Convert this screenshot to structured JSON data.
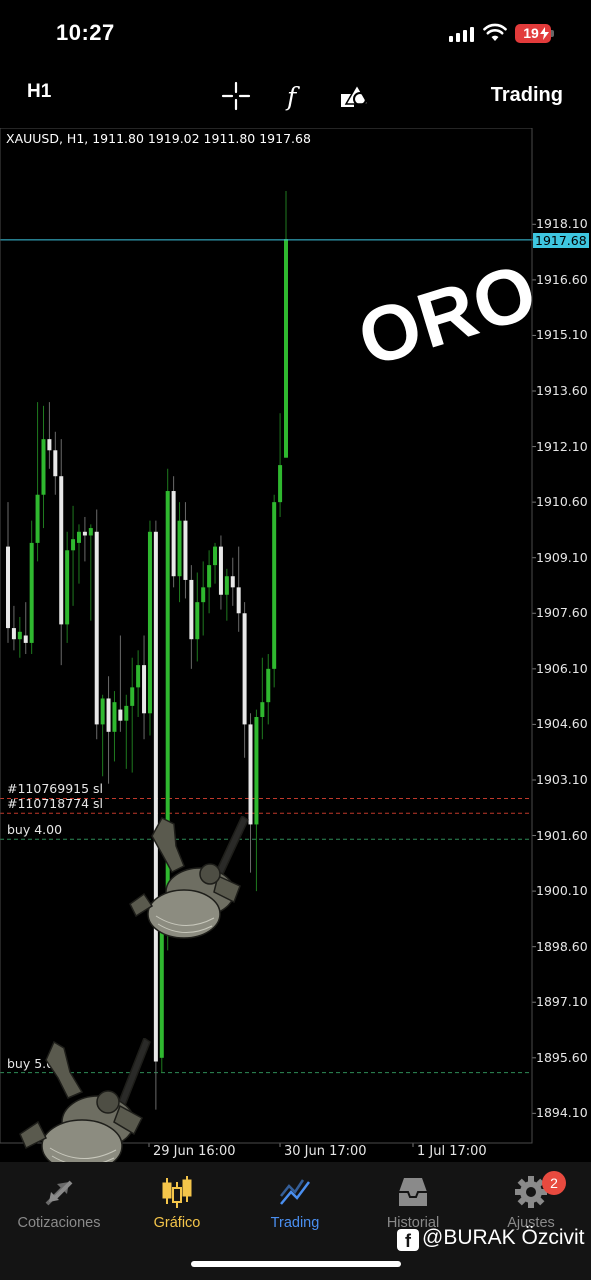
{
  "status_bar": {
    "time": "10:27",
    "battery": "19",
    "battery_color": "#e23b3b"
  },
  "toolbar": {
    "timeframe": "H1",
    "icons": [
      "crosshair-icon",
      "function-icon",
      "objects-icon"
    ],
    "trading_label": "Trading"
  },
  "chart": {
    "header": "XAUUSD, H1, 1911.80 1919.02 1911.80 1917.68",
    "current_price": "1917.68",
    "current_price_color": "#3ec6e0",
    "price_labels": [
      "1918.10",
      "1916.60",
      "1915.10",
      "1913.60",
      "1912.10",
      "1910.60",
      "1909.10",
      "1907.60",
      "1906.10",
      "1904.60",
      "1903.10",
      "1901.60",
      "1900.10",
      "1898.60",
      "1897.10",
      "1895.60",
      "1894.10"
    ],
    "time_labels": [
      "29 Jun 16:00",
      "30 Jun 17:00",
      "1 Jul 17:00"
    ],
    "orders": [
      {
        "label": "#110769915 sl",
        "price": 1902.6,
        "color": "#c0392b"
      },
      {
        "label": "#110718774 sl",
        "price": 1902.2,
        "color": "#c0392b"
      },
      {
        "label": "buy 4.00",
        "price": 1901.5,
        "color": "#2e8b57"
      },
      {
        "label": "buy 5.00",
        "price": 1895.2,
        "color": "#2e8b57"
      }
    ],
    "overlay_text": "ORO",
    "up_color": "#2fb82f",
    "down_color": "#e8e8e8"
  },
  "chart_data": {
    "type": "candlestick",
    "symbol": "XAUUSD",
    "timeframe": "H1",
    "ylim": [
      1893.3,
      1920.7
    ],
    "x_ticks": [
      "29 Jun 16:00",
      "30 Jun 17:00",
      "1 Jul 17:00"
    ],
    "candles": [
      {
        "o": 1909.4,
        "h": 1910.6,
        "l": 1906.8,
        "c": 1907.2
      },
      {
        "o": 1907.2,
        "h": 1907.8,
        "l": 1906.6,
        "c": 1906.9
      },
      {
        "o": 1906.9,
        "h": 1907.5,
        "l": 1906.4,
        "c": 1907.1
      },
      {
        "o": 1907.0,
        "h": 1907.9,
        "l": 1906.5,
        "c": 1906.8
      },
      {
        "o": 1906.8,
        "h": 1910.1,
        "l": 1906.5,
        "c": 1909.5
      },
      {
        "o": 1909.5,
        "h": 1913.3,
        "l": 1909.0,
        "c": 1910.8
      },
      {
        "o": 1910.8,
        "h": 1913.2,
        "l": 1909.9,
        "c": 1912.3
      },
      {
        "o": 1912.3,
        "h": 1913.3,
        "l": 1911.5,
        "c": 1912.0
      },
      {
        "o": 1912.0,
        "h": 1912.5,
        "l": 1910.8,
        "c": 1911.3
      },
      {
        "o": 1911.3,
        "h": 1912.3,
        "l": 1906.2,
        "c": 1907.3
      },
      {
        "o": 1907.3,
        "h": 1909.8,
        "l": 1906.8,
        "c": 1909.3
      },
      {
        "o": 1909.3,
        "h": 1910.5,
        "l": 1907.8,
        "c": 1909.6
      },
      {
        "o": 1909.5,
        "h": 1910.0,
        "l": 1908.4,
        "c": 1909.8
      },
      {
        "o": 1909.8,
        "h": 1910.2,
        "l": 1909.0,
        "c": 1909.7
      },
      {
        "o": 1909.7,
        "h": 1910.0,
        "l": 1907.4,
        "c": 1909.9
      },
      {
        "o": 1909.8,
        "h": 1910.4,
        "l": 1904.2,
        "c": 1904.6
      },
      {
        "o": 1904.6,
        "h": 1905.4,
        "l": 1903.2,
        "c": 1905.3
      },
      {
        "o": 1905.3,
        "h": 1905.9,
        "l": 1903.0,
        "c": 1904.4
      },
      {
        "o": 1904.4,
        "h": 1905.5,
        "l": 1903.6,
        "c": 1905.2
      },
      {
        "o": 1905.0,
        "h": 1907.0,
        "l": 1904.4,
        "c": 1904.7
      },
      {
        "o": 1904.7,
        "h": 1905.4,
        "l": 1903.4,
        "c": 1905.1
      },
      {
        "o": 1905.1,
        "h": 1906.4,
        "l": 1903.3,
        "c": 1905.6
      },
      {
        "o": 1905.6,
        "h": 1906.6,
        "l": 1904.8,
        "c": 1906.2
      },
      {
        "o": 1906.2,
        "h": 1907.0,
        "l": 1904.2,
        "c": 1904.9
      },
      {
        "o": 1904.9,
        "h": 1910.1,
        "l": 1904.3,
        "c": 1909.8
      },
      {
        "o": 1909.8,
        "h": 1910.1,
        "l": 1894.2,
        "c": 1895.5
      },
      {
        "o": 1895.6,
        "h": 1899.6,
        "l": 1895.2,
        "c": 1899.0
      },
      {
        "o": 1899.0,
        "h": 1911.5,
        "l": 1898.5,
        "c": 1910.9
      },
      {
        "o": 1910.9,
        "h": 1911.3,
        "l": 1908.3,
        "c": 1908.6
      },
      {
        "o": 1908.6,
        "h": 1910.6,
        "l": 1907.9,
        "c": 1910.1
      },
      {
        "o": 1910.1,
        "h": 1910.6,
        "l": 1908.0,
        "c": 1908.5
      },
      {
        "o": 1908.5,
        "h": 1908.9,
        "l": 1906.1,
        "c": 1906.9
      },
      {
        "o": 1906.9,
        "h": 1908.7,
        "l": 1906.3,
        "c": 1907.9
      },
      {
        "o": 1907.9,
        "h": 1909.0,
        "l": 1907.0,
        "c": 1908.3
      },
      {
        "o": 1908.3,
        "h": 1909.3,
        "l": 1907.6,
        "c": 1908.9
      },
      {
        "o": 1908.9,
        "h": 1909.5,
        "l": 1908.4,
        "c": 1909.4
      },
      {
        "o": 1909.4,
        "h": 1909.7,
        "l": 1907.7,
        "c": 1908.1
      },
      {
        "o": 1908.1,
        "h": 1908.8,
        "l": 1907.4,
        "c": 1908.6
      },
      {
        "o": 1908.6,
        "h": 1909.1,
        "l": 1907.8,
        "c": 1908.3
      },
      {
        "o": 1908.3,
        "h": 1909.4,
        "l": 1907.1,
        "c": 1907.6
      },
      {
        "o": 1907.6,
        "h": 1907.9,
        "l": 1903.7,
        "c": 1904.6
      },
      {
        "o": 1904.6,
        "h": 1904.9,
        "l": 1900.6,
        "c": 1901.9
      },
      {
        "o": 1901.9,
        "h": 1905.0,
        "l": 1900.1,
        "c": 1904.8
      },
      {
        "o": 1904.8,
        "h": 1906.4,
        "l": 1904.2,
        "c": 1905.2
      },
      {
        "o": 1905.2,
        "h": 1906.5,
        "l": 1904.6,
        "c": 1906.1
      },
      {
        "o": 1906.1,
        "h": 1910.8,
        "l": 1905.6,
        "c": 1910.6
      },
      {
        "o": 1910.6,
        "h": 1913.0,
        "l": 1910.2,
        "c": 1911.6
      },
      {
        "o": 1911.8,
        "h": 1919.0,
        "l": 1911.8,
        "c": 1917.7
      }
    ]
  },
  "watermark": "@BURAK Özcivit",
  "bottom_nav": {
    "items": [
      {
        "label": "Cotizaciones",
        "icon": "quotes-icon",
        "color": "#8a8a8a"
      },
      {
        "label": "Gráfico",
        "icon": "chart-candles-icon",
        "color": "#f4c54a"
      },
      {
        "label": "Trading",
        "icon": "trading-icon",
        "color": "#4a8ff0"
      },
      {
        "label": "Historial",
        "icon": "history-icon",
        "color": "#8a8a8a"
      },
      {
        "label": "Ajustes",
        "icon": "settings-icon",
        "color": "#8a8a8a"
      }
    ],
    "settings_badge": "2"
  }
}
